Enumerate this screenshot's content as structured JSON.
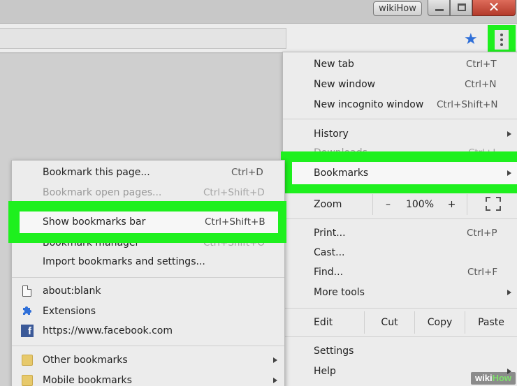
{
  "window": {
    "title_button": "wikiHow",
    "minimize_icon": "minimize-icon",
    "maximize_icon": "maximize-icon",
    "close_icon": "close-icon",
    "close_color": "#c74a38"
  },
  "toolbar": {
    "star_icon": "star-icon",
    "star_glyph": "★",
    "menu_icon": "kebab-menu-icon",
    "highlight_color": "#1ef01e"
  },
  "main_menu": {
    "items": [
      {
        "label": "New tab",
        "shortcut": "Ctrl+T"
      },
      {
        "label": "New window",
        "shortcut": "Ctrl+N"
      },
      {
        "label": "New incognito window",
        "shortcut": "Ctrl+Shift+N"
      },
      {
        "label": "History"
      },
      {
        "label": "Downloads",
        "shortcut": "Ctrl+J"
      },
      {
        "label": "Bookmarks"
      }
    ],
    "zoom": {
      "label": "Zoom",
      "minus": "–",
      "value": "100%",
      "plus": "+",
      "fullscreen_icon": "fullscreen-icon"
    },
    "items2": [
      {
        "label": "Print...",
        "shortcut": "Ctrl+P"
      },
      {
        "label": "Cast..."
      },
      {
        "label": "Find...",
        "shortcut": "Ctrl+F"
      },
      {
        "label": "More tools"
      }
    ],
    "edit": {
      "label": "Edit",
      "cut": "Cut",
      "copy": "Copy",
      "paste": "Paste"
    },
    "items3": [
      {
        "label": "Settings"
      },
      {
        "label": "Help"
      }
    ]
  },
  "bookmarks_menu": {
    "items": [
      {
        "label": "Bookmark this page...",
        "shortcut": "Ctrl+D"
      },
      {
        "label": "Bookmark open pages...",
        "shortcut": "Ctrl+Shift+D"
      },
      {
        "label": "Show bookmarks bar",
        "shortcut": "Ctrl+Shift+B"
      },
      {
        "label": "Bookmark manager",
        "shortcut": "Ctrl+Shift+O"
      },
      {
        "label": "Import bookmarks and settings..."
      }
    ],
    "links": [
      {
        "label": "about:blank",
        "icon": "page-icon"
      },
      {
        "label": "Extensions",
        "icon": "puzzle-piece-icon"
      },
      {
        "label": "https://www.facebook.com",
        "icon": "facebook-icon"
      }
    ],
    "folders": [
      {
        "label": "Other bookmarks",
        "icon": "folder-icon"
      },
      {
        "label": "Mobile bookmarks",
        "icon": "folder-icon"
      }
    ]
  },
  "watermark": {
    "wiki": "wiki",
    "how": "How"
  }
}
